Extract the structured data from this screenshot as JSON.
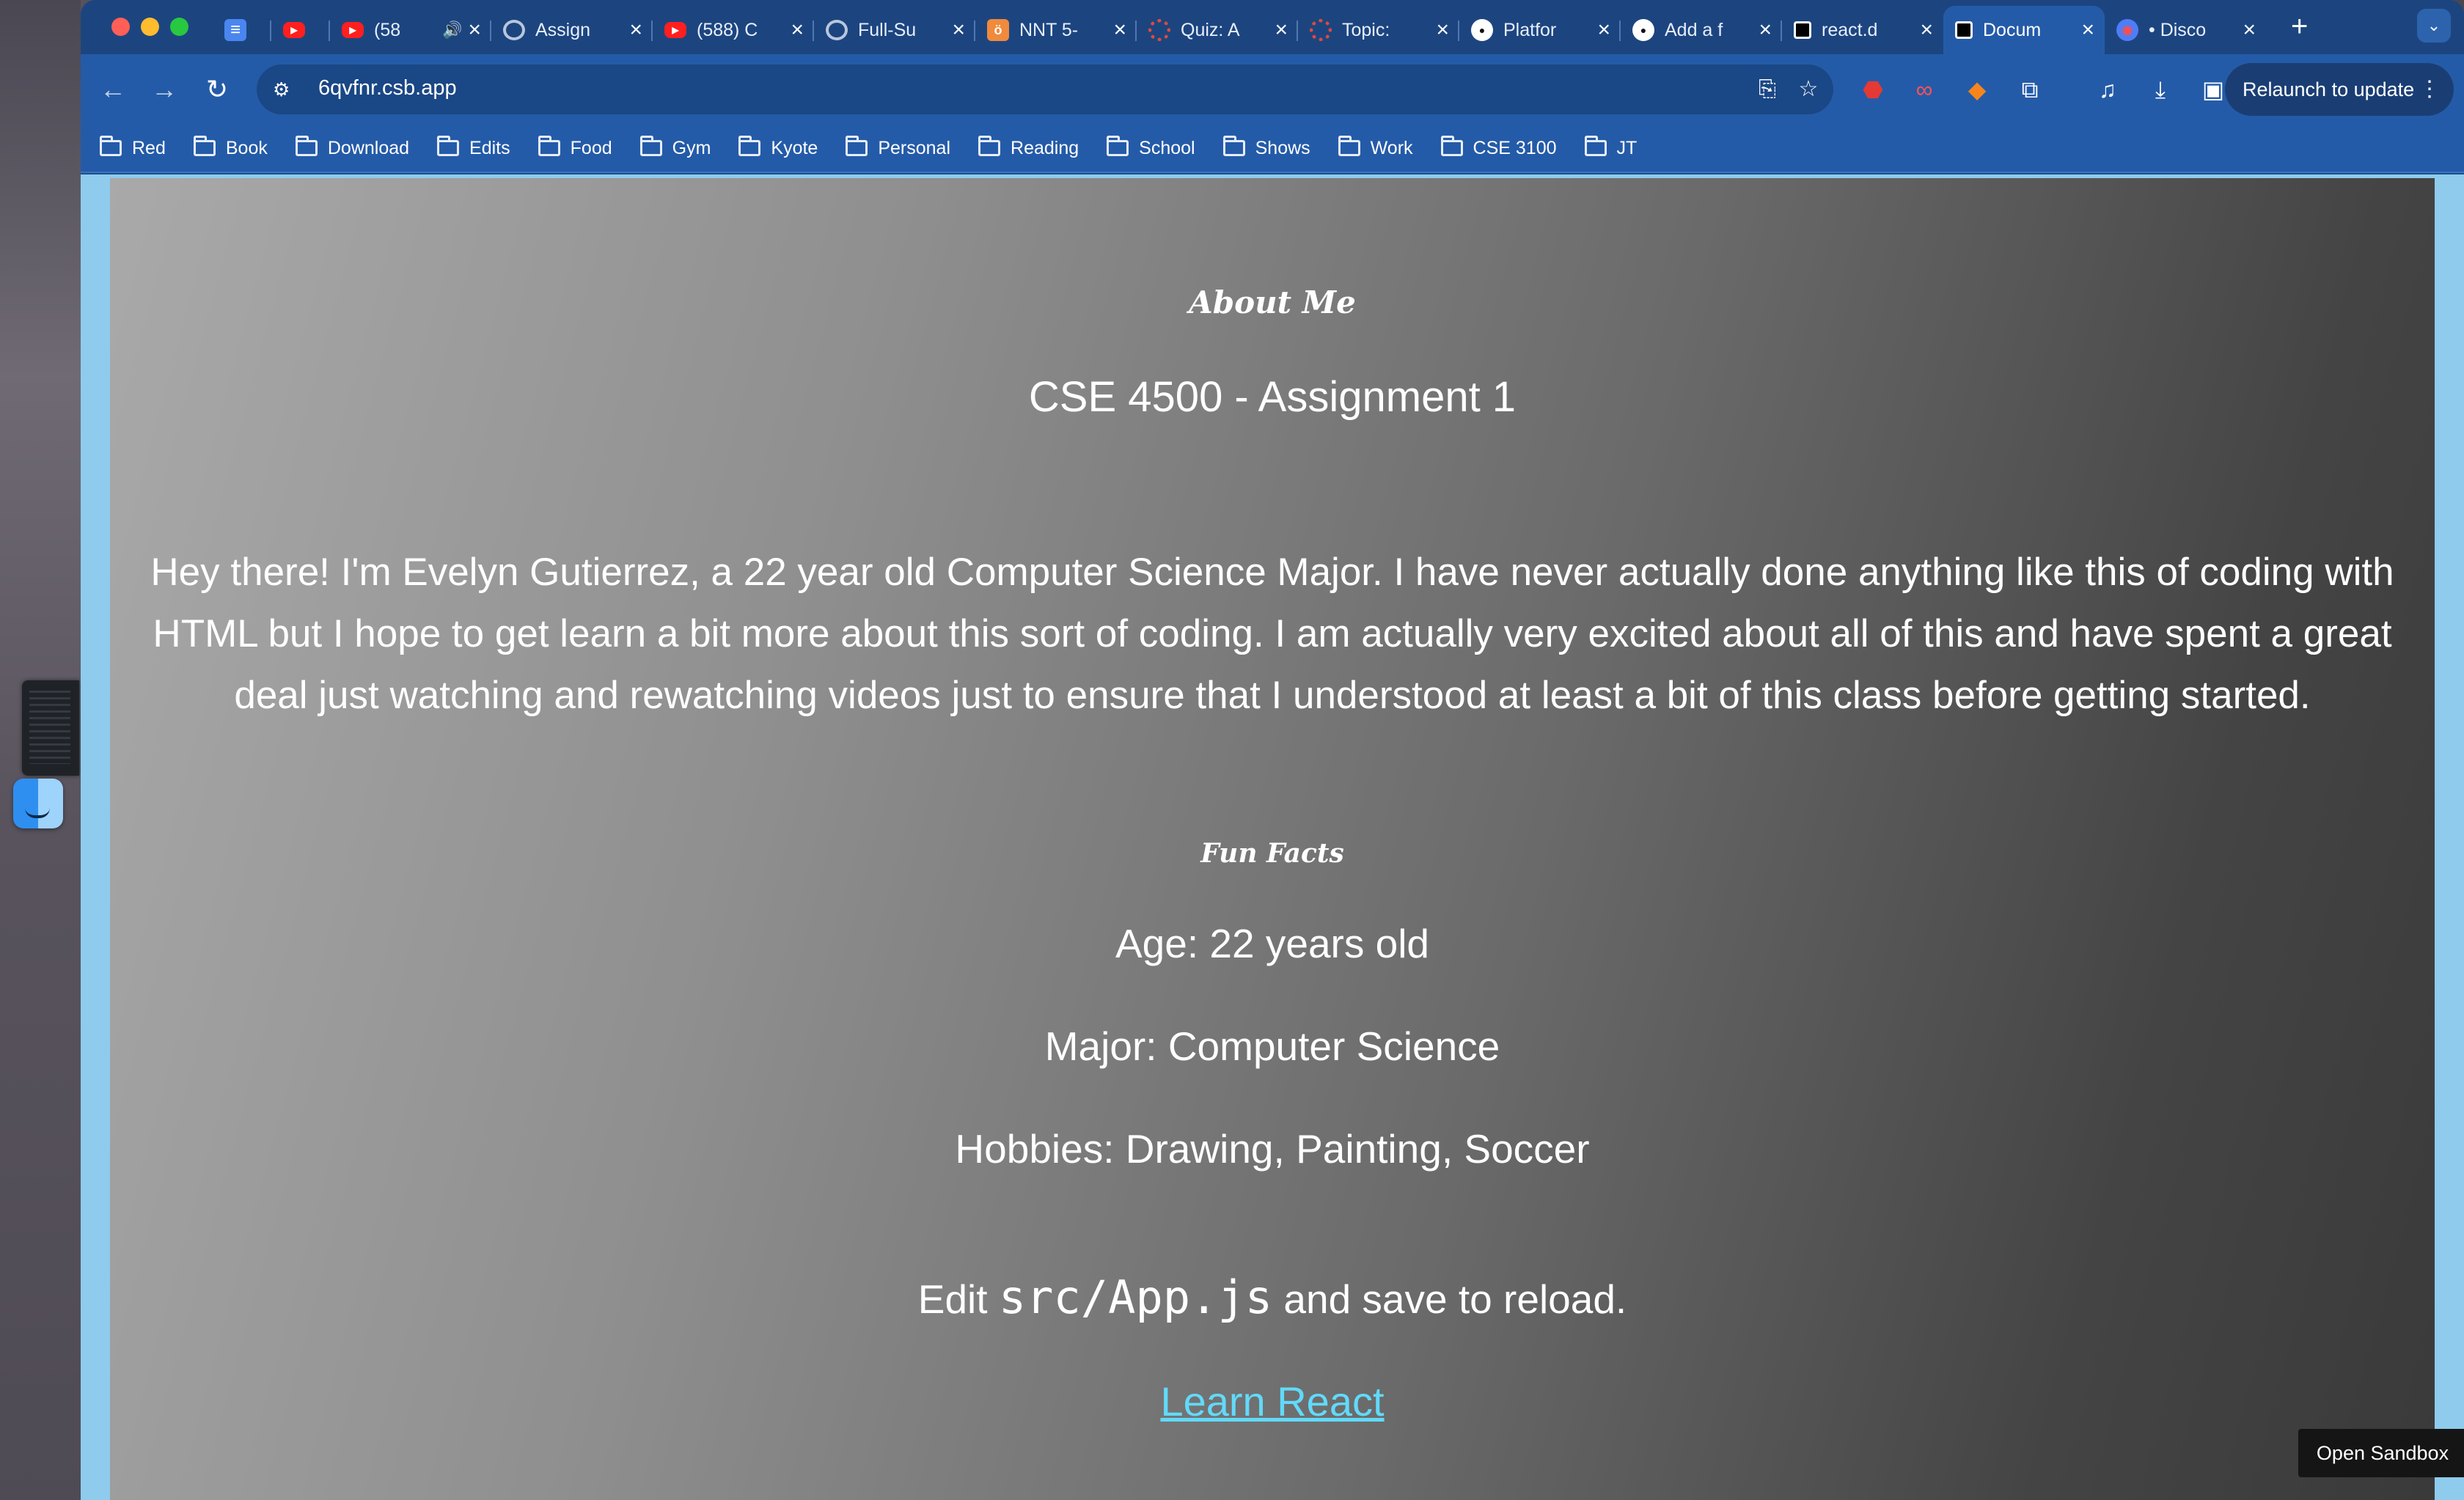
{
  "window": {
    "tabs": [
      {
        "icon": "google-docs-icon",
        "title": ""
      },
      {
        "icon": "youtube-icon",
        "title": ""
      },
      {
        "icon": "youtube-icon",
        "title": "(58",
        "audio": true
      },
      {
        "icon": "loading-ring-icon",
        "title": "Assign"
      },
      {
        "icon": "youtube-icon",
        "title": "(588) C"
      },
      {
        "icon": "loading-ring-icon",
        "title": "Full-Su"
      },
      {
        "icon": "orange-app-icon",
        "title": "NNT 5-"
      },
      {
        "icon": "canvas-icon",
        "title": "Quiz: A"
      },
      {
        "icon": "canvas-icon",
        "title": "Topic: "
      },
      {
        "icon": "github-icon",
        "title": "Platfor"
      },
      {
        "icon": "github-icon",
        "title": "Add a f"
      },
      {
        "icon": "square-icon",
        "title": "react.d"
      },
      {
        "icon": "square-icon",
        "title": "Docum",
        "active": true
      },
      {
        "icon": "discord-icon",
        "title": "• Disco"
      }
    ],
    "new_tab_label": "+"
  },
  "toolbar": {
    "url": "6qvfnr.csb.app",
    "relaunch_label": "Relaunch to update"
  },
  "bookmarks": [
    "Red",
    "Book",
    "Download",
    "Edits",
    "Food",
    "Gym",
    "Kyote",
    "Personal",
    "Reading",
    "School",
    "Shows",
    "Work",
    "CSE 3100",
    "JT"
  ],
  "page": {
    "about_title": "About Me",
    "assignment_title": "CSE 4500 - Assignment 1",
    "bio": "Hey there! I'm Evelyn Gutierrez, a 22 year old Computer Science Major. I have never actually done anything like this of coding with HTML but I hope to get learn a bit more about this sort of coding. I am actually very excited about all of this and have spent a great deal just watching and rewatching videos just to ensure that I understood at least a bit of this class before getting started.",
    "fun_facts_title": "Fun Facts",
    "facts": {
      "age": "Age: 22 years old",
      "major": "Major: Computer Science",
      "hobbies": "Hobbies: Drawing, Painting, Soccer"
    },
    "edit_prefix": "Edit ",
    "edit_code": "src/App.js",
    "edit_suffix": " and save to reload.",
    "learn_link": "Learn React",
    "open_sandbox": "Open Sandbox"
  }
}
